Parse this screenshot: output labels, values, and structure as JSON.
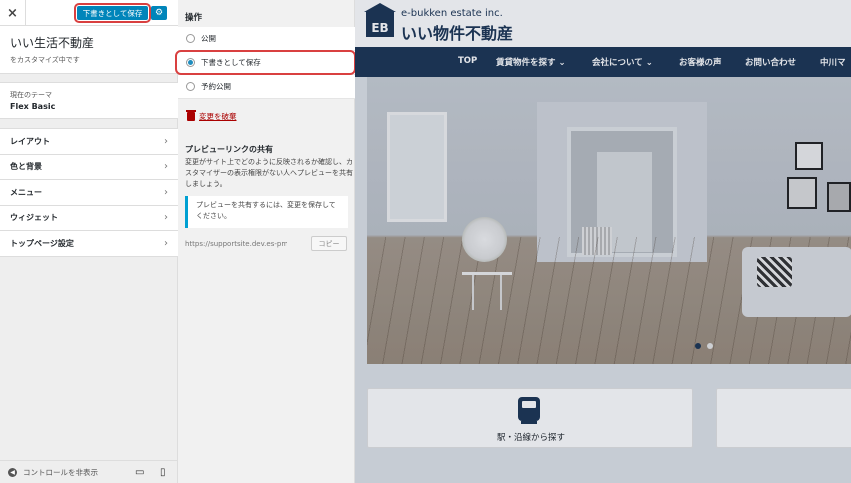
{
  "topbar": {
    "close_icon": "×",
    "save_button": "下書きとして保存",
    "gear_icon": "⚙"
  },
  "site": {
    "title": "いい生活不動産",
    "customizing": "をカスタマイズ中です"
  },
  "theme": {
    "label": "現在のテーマ",
    "name": "Flex Basic"
  },
  "menu": {
    "items": [
      {
        "label": "レイアウト"
      },
      {
        "label": "色と背景"
      },
      {
        "label": "メニュー"
      },
      {
        "label": "ウィジェット"
      },
      {
        "label": "トップページ設定"
      }
    ],
    "chevron": "›"
  },
  "footer": {
    "collapse_label": "コントロールを非表示",
    "collapse_icon": "◀",
    "desktop_icon": "▭",
    "mobile_icon": "▯"
  },
  "publish": {
    "heading": "操作",
    "options": [
      {
        "label": "公開",
        "selected": false
      },
      {
        "label": "下書きとして保存",
        "selected": true
      },
      {
        "label": "予約公開",
        "selected": false
      }
    ],
    "discard_label": "変更を破棄",
    "share_heading": "プレビューリンクの共有",
    "share_description": "変更がサイト上でどのように反映されるか確認し、カスタマイザーの表示権限がない人へプレビューを共有しましょう。",
    "share_notice": "プレビューを共有するには、変更を保存してください。",
    "share_url": "https://supportsite.dev.es-pm.co",
    "copy_button": "コピー"
  },
  "preview": {
    "logo_mark": "EB",
    "logo_sub": "e-bukken estate inc.",
    "logo_main": "いい物件不動産",
    "nav": [
      {
        "label": "TOP"
      },
      {
        "label": "賃貸物件を探す ⌄"
      },
      {
        "label": "会社について ⌄"
      },
      {
        "label": "お客様の声"
      },
      {
        "label": "お問い合わせ"
      },
      {
        "label": "中川マ"
      }
    ],
    "card_label": "駅・沿線から探す",
    "colors": {
      "navy": "#1c3554",
      "accent": "#0085ba",
      "highlight": "#d94040"
    }
  }
}
